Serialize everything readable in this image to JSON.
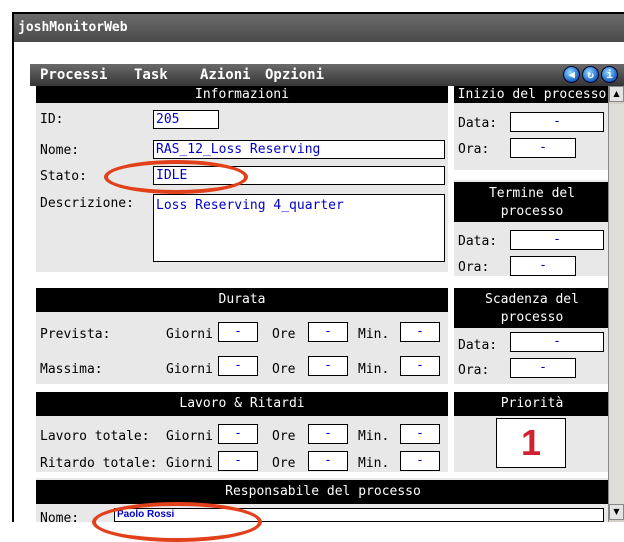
{
  "window": {
    "title": "joshMonitorWeb"
  },
  "menu": {
    "items": [
      "Processi",
      "Task",
      "Azioni",
      "Opzioni"
    ]
  },
  "informazioni": {
    "header": "Informazioni",
    "id_label": "ID:",
    "id_value": "205",
    "nome_label": "Nome:",
    "nome_value": "RAS_12_Loss Reserving",
    "stato_label": "Stato:",
    "stato_value": "IDLE",
    "descrizione_label": "Descrizione:",
    "descrizione_value": "Loss Reserving 4_quarter"
  },
  "inizio": {
    "header": "Inizio del processo",
    "data_label": "Data:",
    "data_value": "-",
    "ora_label": "Ora:",
    "ora_value": "-"
  },
  "termine": {
    "header_line1": "Termine del",
    "header_line2": "processo",
    "data_label": "Data:",
    "data_value": "-",
    "ora_label": "Ora:",
    "ora_value": "-"
  },
  "durata": {
    "header": "Durata",
    "prevista_label": "Prevista:",
    "massima_label": "Massima:",
    "giorni_label": "Giorni",
    "ore_label": "Ore",
    "min_label": "Min.",
    "value": "-"
  },
  "scadenza": {
    "header_line1": "Scadenza del",
    "header_line2": "processo",
    "data_label": "Data:",
    "data_value": "-",
    "ora_label": "Ora:",
    "ora_value": "-"
  },
  "lavoro": {
    "header": "Lavoro & Ritardi",
    "lavoro_label": "Lavoro totale:",
    "ritardo_label": "Ritardo totale:",
    "giorni_label": "Giorni",
    "ore_label": "Ore",
    "min_label": "Min.",
    "value": "-"
  },
  "priorita": {
    "header": "Priorità",
    "value": "1"
  },
  "responsabile": {
    "header": "Responsabile del processo",
    "nome_label": "Nome:",
    "nome_value": "Paolo Rossi"
  },
  "colors": {
    "accent_red": "#e2401b",
    "value_blue": "#0000c8",
    "priority_red": "#d0222e"
  }
}
